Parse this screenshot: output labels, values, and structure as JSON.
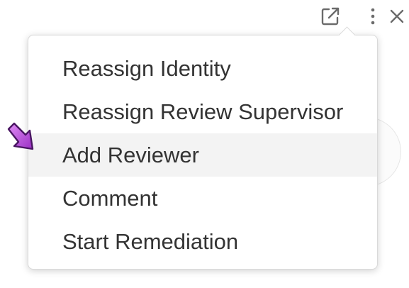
{
  "header": {
    "icons": [
      "external-link-icon",
      "more-vertical-icon",
      "close-icon"
    ]
  },
  "menu": {
    "items": [
      {
        "label": "Reassign Identity"
      },
      {
        "label": "Reassign Review Supervisor"
      },
      {
        "label": "Add Reviewer",
        "highlighted": true
      },
      {
        "label": "Comment"
      },
      {
        "label": "Start Remediation"
      }
    ]
  },
  "colors": {
    "menu_text": "#333333",
    "hover_bg": "#f3f3f3",
    "icon": "#6b6b6b",
    "pointer_arrow": "#b44bd8"
  }
}
